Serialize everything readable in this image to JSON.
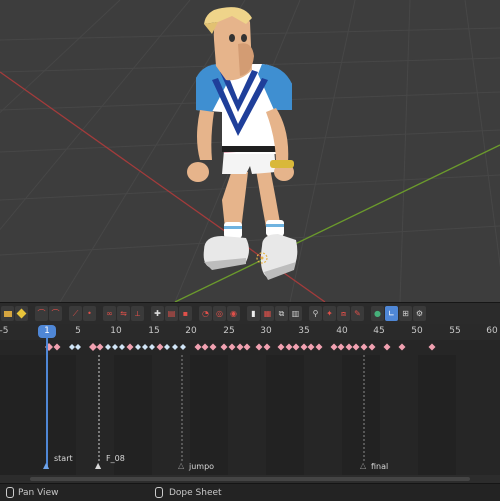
{
  "timeline": {
    "current_frame": "1",
    "ruler_labels": [
      "-5",
      "5",
      "10",
      "15",
      "20",
      "25",
      "30",
      "35",
      "40",
      "45",
      "50",
      "55",
      "60"
    ],
    "markers": [
      {
        "label": "start"
      },
      {
        "label": "F_08"
      },
      {
        "label": "jumpo"
      },
      {
        "label": "final"
      }
    ]
  },
  "statusbar": {
    "left_label": "Pan View",
    "mid_label": "Dope Sheet"
  },
  "colors": {
    "playhead": "#4f87d6",
    "keyframe_selected": "#f0a0b0",
    "keyframe_plain": "#cfe3f5",
    "viewport_bg": "#3d3d3d",
    "x_axis": "#b03a3a",
    "y_axis": "#6a9a2a"
  },
  "toolbar_icons": [
    "key-icon",
    "keyframe-yellow-icon",
    "curve-red-icon",
    "curve-red-icon-2",
    "curve-ease-icon",
    "curve-dot-icon",
    "loop-icon",
    "mirror-icon",
    "handle-icon",
    "constraint-icon",
    "bake-icon",
    "insert-key-icon",
    "clock-icon",
    "select-icon",
    "select-range-icon",
    "bookmark-icon",
    "snapshot-icon",
    "duplicate-icon",
    "delete-icon",
    "link-icon",
    "pose-icon",
    "copy-icon",
    "paste-icon",
    "flip-icon",
    "globe-icon",
    "axis-icon",
    "marker-icon",
    "settings-icon"
  ]
}
